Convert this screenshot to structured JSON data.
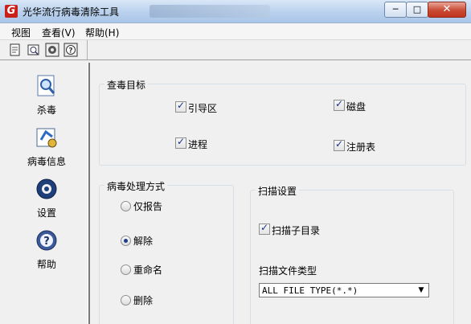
{
  "window": {
    "title": "光华流行病毒清除工具",
    "controls": {
      "minimize": "─",
      "maximize": "□",
      "close": "✕"
    }
  },
  "menu": [
    "视图",
    "查看(V)",
    "帮助(H)"
  ],
  "toolbar": [
    "file-new-icon",
    "open-icon",
    "settings-icon",
    "help-icon"
  ],
  "sidebar": [
    {
      "label": "杀毒",
      "icon": "scan-magnifier-icon"
    },
    {
      "label": "病毒信息",
      "icon": "virus-info-icon"
    },
    {
      "label": "设置",
      "icon": "settings-gear-icon"
    },
    {
      "label": "帮助",
      "icon": "help-icon"
    }
  ],
  "targets": {
    "title": "查毒目标",
    "items": [
      "引导区",
      "磁盘",
      "进程",
      "注册表"
    ]
  },
  "handling": {
    "title": "病毒处理方式",
    "options": [
      "仅报告",
      "解除",
      "重命名",
      "删除"
    ],
    "selected": "解除"
  },
  "scan": {
    "title": "扫描设置",
    "subdirs": "扫描子目录",
    "file_type_label": "扫描文件类型",
    "file_type_value": "ALL FILE TYPE(*.*)"
  }
}
